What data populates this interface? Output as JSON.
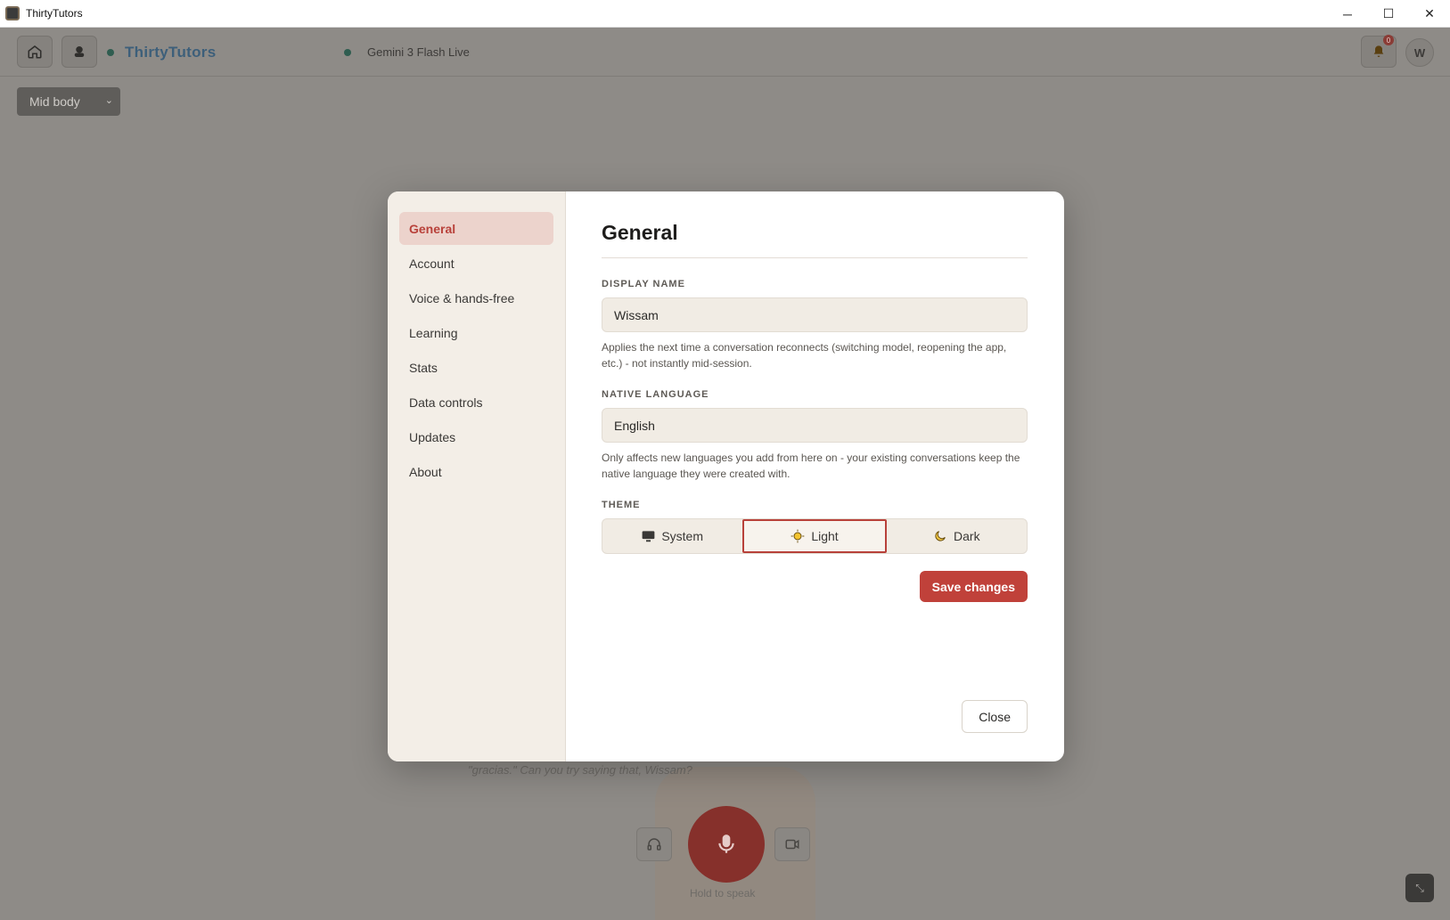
{
  "window": {
    "title": "ThirtyTutors",
    "controls": {
      "minimize": "─",
      "maximize": "☐",
      "close": "✕"
    }
  },
  "header": {
    "brand": "ThirtyTutors",
    "model_label": "Gemini 3 Flash Live",
    "notification_count": "0",
    "avatar_initial": "W",
    "status_color": "#2f5d50"
  },
  "toolbar": {
    "body_select": "Mid body"
  },
  "background": {
    "subtitle": "\"gracias.\" Can you try saying that, Wissam?",
    "hold_to_speak": "Hold to speak"
  },
  "settings": {
    "nav": [
      {
        "label": "General",
        "active": true
      },
      {
        "label": "Account"
      },
      {
        "label": "Voice & hands-free"
      },
      {
        "label": "Learning"
      },
      {
        "label": "Stats"
      },
      {
        "label": "Data controls"
      },
      {
        "label": "Updates"
      },
      {
        "label": "About"
      }
    ],
    "title": "General",
    "display_name": {
      "label": "DISPLAY NAME",
      "value": "Wissam",
      "help": "Applies the next time a conversation reconnects (switching model, reopening the app, etc.) - not instantly mid-session."
    },
    "native_language": {
      "label": "NATIVE LANGUAGE",
      "value": "English",
      "help": "Only affects new languages you add from here on - your existing conversations keep the native language they were created with."
    },
    "theme": {
      "label": "THEME",
      "options": [
        {
          "label": "System",
          "icon": "monitor-icon"
        },
        {
          "label": "Light",
          "icon": "sun-icon",
          "selected": true
        },
        {
          "label": "Dark",
          "icon": "moon-icon"
        }
      ]
    },
    "save_label": "Save changes",
    "close_label": "Close",
    "accent_color": "#c0413a"
  }
}
